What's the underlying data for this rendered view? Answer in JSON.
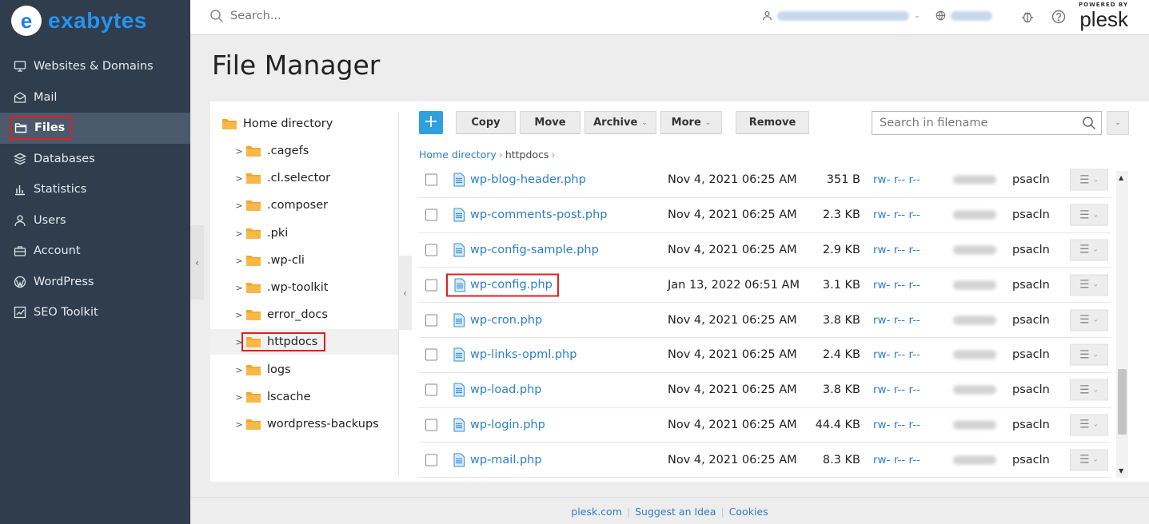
{
  "brand": {
    "logo_letter": "e",
    "logo_text": "exabytes"
  },
  "sidebar": {
    "items": [
      {
        "label": "Websites & Domains",
        "icon": "monitor-icon"
      },
      {
        "label": "Mail",
        "icon": "envelope-icon"
      },
      {
        "label": "Files",
        "icon": "folder-icon",
        "active": true
      },
      {
        "label": "Databases",
        "icon": "database-icon"
      },
      {
        "label": "Statistics",
        "icon": "bar-chart-icon"
      },
      {
        "label": "Users",
        "icon": "user-icon"
      },
      {
        "label": "Account",
        "icon": "briefcase-icon"
      },
      {
        "label": "WordPress",
        "icon": "wordpress-icon"
      },
      {
        "label": "SEO Toolkit",
        "icon": "seo-chart-icon"
      }
    ]
  },
  "topbar": {
    "search_placeholder": "Search...",
    "plesk_powered": "POWERED BY",
    "plesk_word": "plesk"
  },
  "page": {
    "title": "File Manager"
  },
  "tree": {
    "root": "Home directory",
    "items": [
      ".cagefs",
      ".cl.selector",
      ".composer",
      ".pki",
      ".wp-cli",
      ".wp-toolkit",
      "error_docs",
      "httpdocs",
      "logs",
      "lscache",
      "wordpress-backups"
    ],
    "selected": "httpdocs"
  },
  "toolbar": {
    "add_label": "+",
    "copy": "Copy",
    "move": "Move",
    "archive": "Archive",
    "more": "More",
    "remove": "Remove",
    "search_placeholder": "Search in filename"
  },
  "breadcrumb": {
    "root": "Home directory",
    "current": "httpdocs"
  },
  "files": [
    {
      "name": "wp-blog-header.php",
      "date": "Nov 4, 2021 06:25 AM",
      "size": "351 B",
      "perms": "rw- r-- r--",
      "group": "psacln"
    },
    {
      "name": "wp-comments-post.php",
      "date": "Nov 4, 2021 06:25 AM",
      "size": "2.3 KB",
      "perms": "rw- r-- r--",
      "group": "psacln"
    },
    {
      "name": "wp-config-sample.php",
      "date": "Nov 4, 2021 06:25 AM",
      "size": "2.9 KB",
      "perms": "rw- r-- r--",
      "group": "psacln"
    },
    {
      "name": "wp-config.php",
      "date": "Jan 13, 2022 06:51 AM",
      "size": "3.1 KB",
      "perms": "rw- r-- r--",
      "group": "psacln",
      "highlighted": true
    },
    {
      "name": "wp-cron.php",
      "date": "Nov 4, 2021 06:25 AM",
      "size": "3.8 KB",
      "perms": "rw- r-- r--",
      "group": "psacln"
    },
    {
      "name": "wp-links-opml.php",
      "date": "Nov 4, 2021 06:25 AM",
      "size": "2.4 KB",
      "perms": "rw- r-- r--",
      "group": "psacln"
    },
    {
      "name": "wp-load.php",
      "date": "Nov 4, 2021 06:25 AM",
      "size": "3.8 KB",
      "perms": "rw- r-- r--",
      "group": "psacln"
    },
    {
      "name": "wp-login.php",
      "date": "Nov 4, 2021 06:25 AM",
      "size": "44.4 KB",
      "perms": "rw- r-- r--",
      "group": "psacln"
    },
    {
      "name": "wp-mail.php",
      "date": "Nov 4, 2021 06:25 AM",
      "size": "8.3 KB",
      "perms": "rw- r-- r--",
      "group": "psacln"
    }
  ],
  "footer": {
    "links": [
      "plesk.com",
      "Suggest an Idea",
      "Cookies"
    ]
  },
  "colors": {
    "sidebar_bg": "#2f3d4d",
    "accent": "#2f9fe0",
    "link": "#2a7fc9",
    "highlight": "#e02020"
  }
}
